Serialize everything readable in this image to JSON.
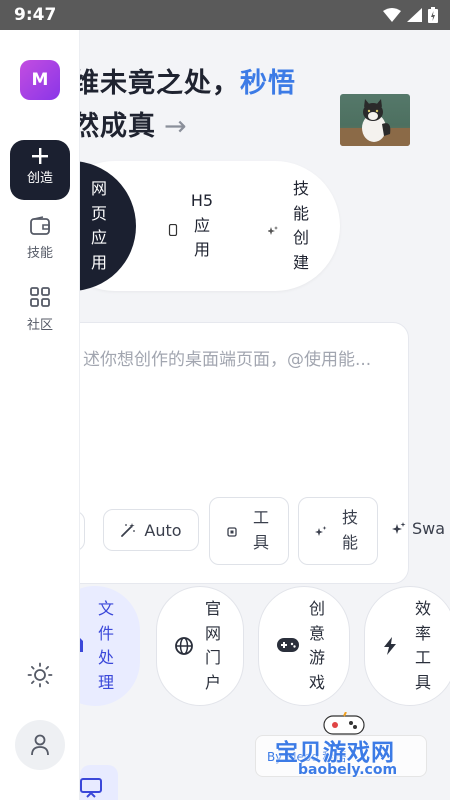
{
  "status_bar": {
    "time": "9:47",
    "icons": [
      "wifi-icon",
      "signal-icon",
      "battery-icon"
    ]
  },
  "sidebar": {
    "avatar_letter": "M",
    "nav": [
      {
        "label": "创造",
        "icon": "plus-icon",
        "active": true
      },
      {
        "label": "技能",
        "icon": "wallet-icon",
        "active": false
      },
      {
        "label": "社区",
        "icon": "grid-icon",
        "active": false
      }
    ],
    "bottom_icons": [
      "sun-icon",
      "user-icon"
    ]
  },
  "hero": {
    "line1_prefix": "维未竟之处，",
    "line1_accent": "秒悟",
    "line2": "然成真",
    "arrow": "→"
  },
  "modes": [
    {
      "label": "网页应用",
      "icon": null,
      "active": true
    },
    {
      "label": "H5应用",
      "icon": "phone-icon",
      "active": false
    },
    {
      "label": "技能创建",
      "icon": "sparkle-icon",
      "active": false
    }
  ],
  "composer": {
    "placeholder": "述你想创作的桌面端页面，@使用能..."
  },
  "chips": {
    "auto": {
      "label": "Auto",
      "icon": "magic-wand-icon"
    },
    "tools": {
      "label": "工具",
      "icon": "chip-icon"
    },
    "skills": {
      "label": "技能",
      "icon": "sparkle-icon"
    },
    "swa": {
      "label": "Swa",
      "icon": "sparkles-icon"
    }
  },
  "categories": [
    {
      "label": "文件处理",
      "icon": "document-icon",
      "active": true
    },
    {
      "label": "官网门户",
      "icon": "globe-icon",
      "active": false
    },
    {
      "label": "创意游戏",
      "icon": "gamepad-icon",
      "active": false
    },
    {
      "label": "效率工具",
      "icon": "bolt-icon",
      "active": false
    }
  ],
  "watermark": {
    "small": "By Meoo 秒悟",
    "big": "宝贝游戏网",
    "url": "baobely.com"
  },
  "colors": {
    "accent": "#3c7be6",
    "dark": "#1b2030",
    "brand_gradient": [
      "#c34de0",
      "#8a36e8"
    ],
    "active_category_bg": "#e9ecff"
  }
}
